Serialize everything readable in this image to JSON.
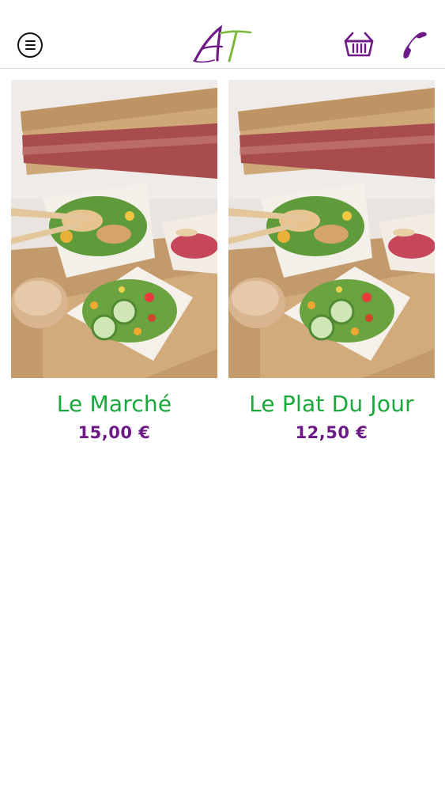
{
  "header": {
    "menu_icon": "hamburger-menu-icon",
    "logo_text": "AT",
    "cart_icon": "basket-icon",
    "phone_icon": "phone-icon"
  },
  "colors": {
    "product_name": "#19a83a",
    "price": "#6d1a86",
    "icon_purple": "#6d1a86",
    "logo_green": "#7cb83c"
  },
  "products": [
    {
      "name": "Le Marché",
      "price": "15,00 €",
      "image": "salad-lunchbox-photo"
    },
    {
      "name": "Le Plat Du Jour",
      "price": "12,50 €",
      "image": "salad-lunchbox-photo"
    }
  ]
}
